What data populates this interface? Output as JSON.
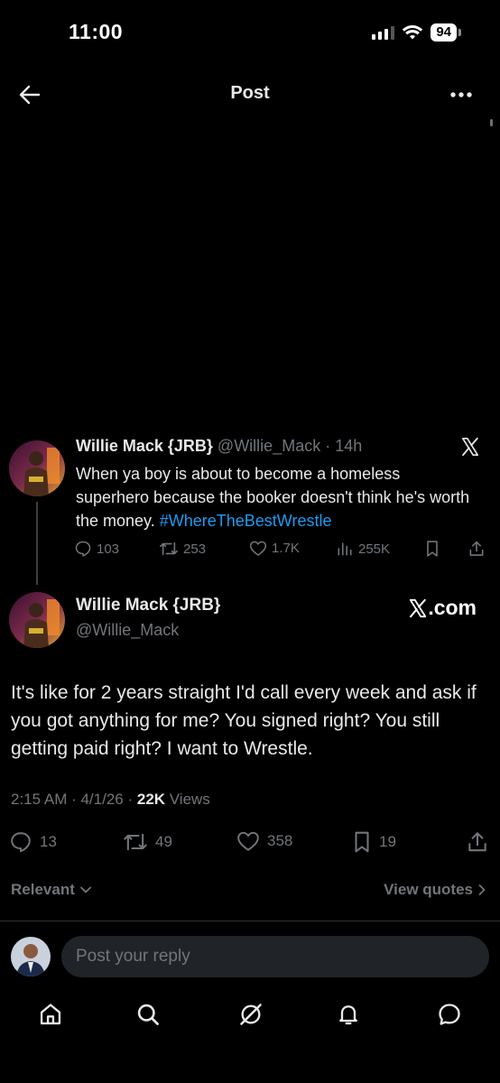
{
  "status_bar": {
    "time": "11:00",
    "battery": "94"
  },
  "nav": {
    "title": "Post"
  },
  "quoted_post": {
    "author_name": "Willie Mack {JRB}",
    "handle": "@Willie_Mack",
    "separator": "·",
    "time": "14h",
    "text": "When ya boy is about to become a homeless superhero because the booker doesn't think he's worth the money. ",
    "hashtag": "#WhereTheBestWrestle",
    "actions": {
      "replies": "103",
      "reposts": "253",
      "likes": "1.7K",
      "views": "255K"
    }
  },
  "main_post": {
    "author_name": "Willie Mack {JRB}",
    "handle": "@Willie_Mack",
    "source_label": ".com",
    "text": "It's like for 2 years straight I'd call every week and ask if you got anything for me? You signed right? You still getting paid right? I want to Wrestle.",
    "timestamp": "2:15 AM · 4/1/26 · ",
    "views_count": "22K",
    "views_label": " Views",
    "actions": {
      "replies": "13",
      "reposts": "49",
      "likes": "358",
      "bookmarks": "19"
    }
  },
  "filters": {
    "sort_label": "Relevant",
    "view_quotes_label": "View quotes"
  },
  "reply": {
    "placeholder": "Post your reply"
  },
  "colors": {
    "background": "#000000",
    "text": "#e7e9ea",
    "muted": "#71767b",
    "link": "#1d9bf0",
    "input_bg": "#202327"
  },
  "icons": {
    "back": "arrow-left-icon",
    "more": "more-horizontal-icon",
    "x_logo": "x-logo-icon",
    "reply": "speech-bubble-icon",
    "repost": "repost-icon",
    "like": "heart-icon",
    "views": "bar-chart-icon",
    "bookmark": "bookmark-icon",
    "share": "share-icon",
    "nav": [
      "home-icon",
      "search-icon",
      "grok-icon",
      "bell-icon",
      "messages-icon"
    ]
  }
}
